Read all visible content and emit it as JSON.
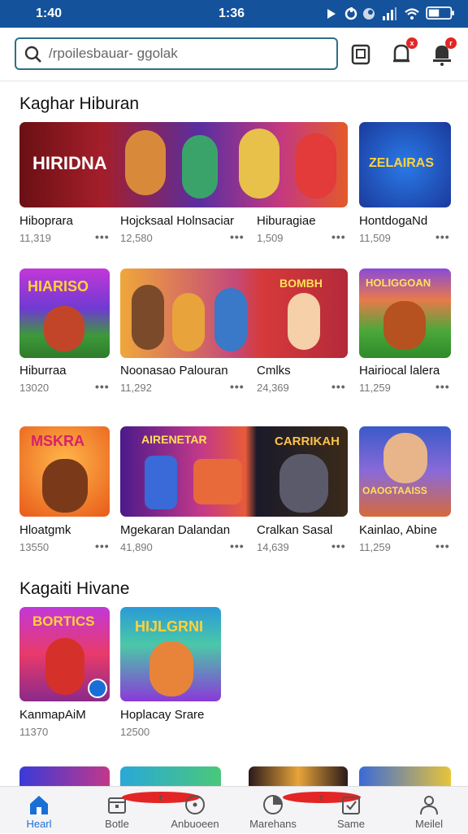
{
  "status_bar": {
    "left_time": "1:40",
    "center_time": "1:36"
  },
  "search": {
    "placeholder": "/rpoilesbauar- ggolak"
  },
  "toolbar": {
    "notification_badge": "x",
    "alert_badge": "r"
  },
  "sections": [
    {
      "title": "Kaghar Hiburan"
    },
    {
      "title": "Kagaiti Hivane"
    }
  ],
  "cards": [
    {
      "title": "Hiboprara",
      "count": "11,319",
      "art_text": "HIRIDNA"
    },
    {
      "title": "Hojcksaal Holnsaciar",
      "count": "12,580",
      "art_text": ""
    },
    {
      "title": "Hiburagiae",
      "count": "1,509",
      "art_text": ""
    },
    {
      "title": "HontdogaNd",
      "count": "11,509",
      "art_text": "ZELAIRAS"
    },
    {
      "title": "Hiburraa",
      "count": "13020",
      "art_text": "HIARISO"
    },
    {
      "title": "Noonasao Palouran",
      "count": "11,292",
      "art_text": ""
    },
    {
      "title": "Cmlks",
      "count": "24,369",
      "art_text": "BOMBH"
    },
    {
      "title": "Hairiocal lalera",
      "count": "11,259",
      "art_text": "HOLIGGOAN"
    },
    {
      "title": "Hloatgmk",
      "count": "13550",
      "art_text": "MSKRA"
    },
    {
      "title": "Mgekaran Dalandan",
      "count": "41,890",
      "art_text": "AIRENETAR"
    },
    {
      "title": "Cralkan Sasal",
      "count": "14,639",
      "art_text": "CARRIKAH"
    },
    {
      "title": "Kainlao, Abine",
      "count": "11,259",
      "art_text": "OAOGTAAISS"
    },
    {
      "title": "KanmapAiM",
      "count": "11370",
      "art_text": "BORTICS"
    },
    {
      "title": "Hoplacay Srare",
      "count": "12500",
      "art_text": "HIJLGRNI"
    }
  ],
  "nav": [
    {
      "label": "Hearl",
      "icon": "home-icon"
    },
    {
      "label": "Botle",
      "icon": "calendar-icon",
      "badge": "r"
    },
    {
      "label": "Anbuoeen",
      "icon": "compass-icon"
    },
    {
      "label": "Marehans",
      "icon": "chart-icon",
      "badge": "r"
    },
    {
      "label": "Same",
      "icon": "checklist-icon"
    },
    {
      "label": "Meilel",
      "icon": "person-icon"
    }
  ],
  "colors": {
    "status_bar": "#14529c",
    "accent": "#1a6fd6",
    "badge": "#e42525"
  }
}
